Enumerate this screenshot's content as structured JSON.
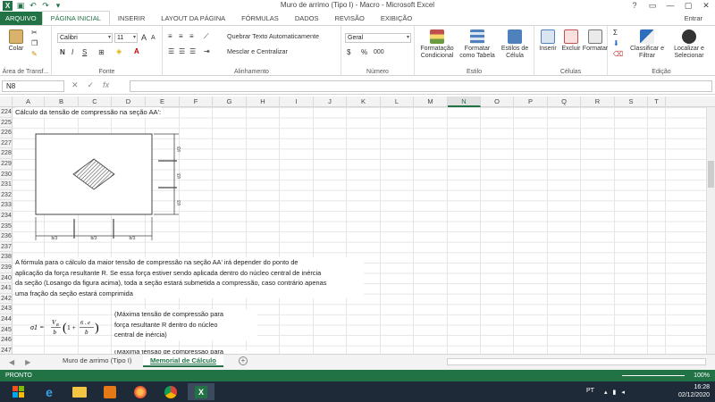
{
  "window": {
    "title": "Muro de arrimo (Tipo I) - Macro - Microsoft Excel",
    "controls": [
      "?",
      "▭",
      "—",
      "▢",
      "✕"
    ],
    "user": "Entrar"
  },
  "ribbon_tabs": [
    "ARQUIVO",
    "PÁGINA INICIAL",
    "INSERIR",
    "LAYOUT DA PÁGINA",
    "FÓRMULAS",
    "DADOS",
    "REVISÃO",
    "EXIBIÇÃO"
  ],
  "ribbon": {
    "clipboard": {
      "paste": "Colar",
      "label": "Área de Transf..."
    },
    "font": {
      "name": "Calibri",
      "size": "11",
      "label": "Fonte",
      "bold": "N",
      "italic": "I",
      "underline": "S",
      "grow": "A",
      "shrink": "A"
    },
    "alignment": {
      "wrap": "Quebrar Texto Automaticamente",
      "merge": "Mesclar e Centralizar",
      "label": "Alinhamento"
    },
    "number": {
      "format": "Geral",
      "label": "Número",
      "percent": "%",
      "thousands": "000"
    },
    "styles": {
      "conditional": "Formatação Condicional",
      "table": "Formatar como Tabela",
      "cell": "Estilos de Célula",
      "label": "Estilo"
    },
    "cells": {
      "insert": "Inserir",
      "delete": "Excluir",
      "format": "Formatar",
      "label": "Células"
    },
    "editing": {
      "sort": "Classificar e Filtrar",
      "find": "Localizar e Selecionar",
      "label": "Edição"
    }
  },
  "formula_bar": {
    "cell_ref": "N8",
    "fx": "fx",
    "value": ""
  },
  "columns": [
    "A",
    "B",
    "C",
    "D",
    "E",
    "F",
    "G",
    "H",
    "I",
    "J",
    "K",
    "L",
    "M",
    "N",
    "O",
    "P",
    "Q",
    "R",
    "S",
    "T"
  ],
  "selected_column": "N",
  "rows": [
    "224",
    "225",
    "226",
    "227",
    "228",
    "229",
    "230",
    "231",
    "232",
    "233",
    "234",
    "235",
    "236",
    "237",
    "238",
    "239",
    "240",
    "241",
    "242",
    "243",
    "244",
    "245",
    "246",
    "247"
  ],
  "content": {
    "heading": "Cálculo da tensão de compressão na seção AA':",
    "dim_bottom": [
      "b/3",
      "b/3",
      "b/3"
    ],
    "dim_right": [
      "t/3",
      "t/3",
      "t/3"
    ],
    "paragraph": [
      "A fórmula para o cálculo da maior tensão de compressão na seção AA' irá depender do ponto de",
      "aplicação da força resultante R. Se essa força estiver sendo aplicada dentro do núcleo central de inércia",
      "da seção (Losango da figura acima), toda a seção estará submetida a compressão, caso contrário apenas",
      "uma fração da seção estará comprimida"
    ],
    "formula": {
      "lhs": "σ1 =",
      "num": "V",
      "sub": "R",
      "den": "b",
      "paren_num": "6 . e",
      "paren_den": "b",
      "one": "1 +"
    },
    "note1": [
      "(Máxima tensão de compressão para",
      "força resultante R dentro do núcleo",
      "central de inércia)"
    ],
    "note2": "(Máxima tensão de compressão para"
  },
  "sheets": [
    {
      "name": "Muro de arrimo (Tipo I)",
      "active": false
    },
    {
      "name": "Memorial de Cálculo",
      "active": true
    }
  ],
  "status": {
    "ready": "PRONTO",
    "zoom": "100%"
  },
  "taskbar": {
    "lang": "PT",
    "time": "16:28",
    "date": "02/12/2020"
  }
}
